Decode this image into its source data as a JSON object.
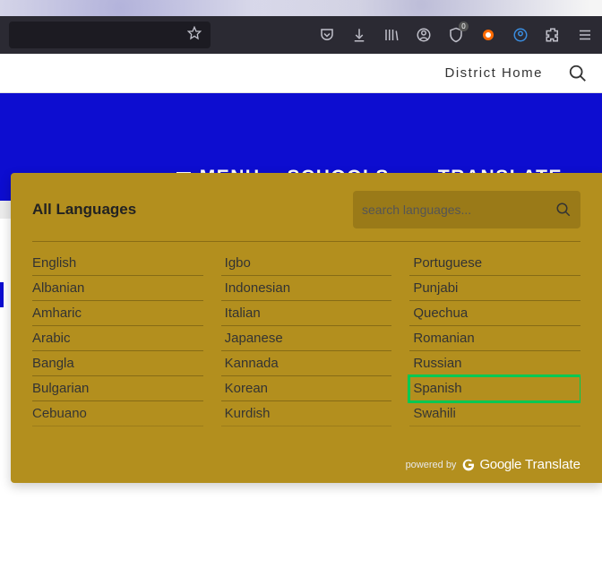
{
  "browser": {
    "shield_badge": "0"
  },
  "district_bar": {
    "home_label": "District Home"
  },
  "nav": {
    "menu_label": "MENU",
    "schools_label": "SCHOOLS",
    "translate_label": "TRANSLATE"
  },
  "panel": {
    "title": "All Languages",
    "search_placeholder": "search languages...",
    "powered_by": "powered by",
    "google_word": "Google",
    "translate_word": "Translate",
    "selected": "English",
    "highlighted": "Spanish",
    "columns": [
      [
        "English",
        "Albanian",
        "Amharic",
        "Arabic",
        "Bangla",
        "Bulgarian",
        "Cebuano"
      ],
      [
        "Igbo",
        "Indonesian",
        "Italian",
        "Japanese",
        "Kannada",
        "Korean",
        "Kurdish"
      ],
      [
        "Portuguese",
        "Punjabi",
        "Quechua",
        "Romanian",
        "Russian",
        "Spanish",
        "Swahili"
      ]
    ]
  }
}
